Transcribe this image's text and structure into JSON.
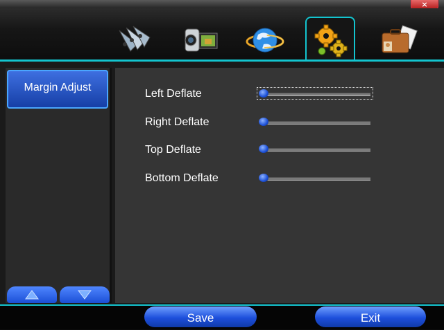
{
  "window": {
    "close_glyph": "×"
  },
  "tabs": [
    {
      "name": "record-tab",
      "icon": "film-reel-icon"
    },
    {
      "name": "camera-tab",
      "icon": "video-camera-icon"
    },
    {
      "name": "network-tab",
      "icon": "globe-network-icon"
    },
    {
      "name": "settings-tab",
      "icon": "gears-icon",
      "active": true
    },
    {
      "name": "system-info-tab",
      "icon": "briefcase-icon"
    }
  ],
  "sidebar": {
    "items": [
      {
        "label": "Margin Adjust"
      }
    ],
    "up_icon": "triangle-up-icon",
    "down_icon": "triangle-down-icon"
  },
  "settings": {
    "rows": [
      {
        "label": "Left Deflate",
        "value": 0
      },
      {
        "label": "Right Deflate",
        "value": 0
      },
      {
        "label": "Top Deflate",
        "value": 0
      },
      {
        "label": "Bottom Deflate",
        "value": 0
      }
    ]
  },
  "footer": {
    "save_label": "Save",
    "exit_label": "Exit"
  },
  "colors": {
    "accent": "#13c4cf",
    "button_blue": "#1d4fdc"
  }
}
